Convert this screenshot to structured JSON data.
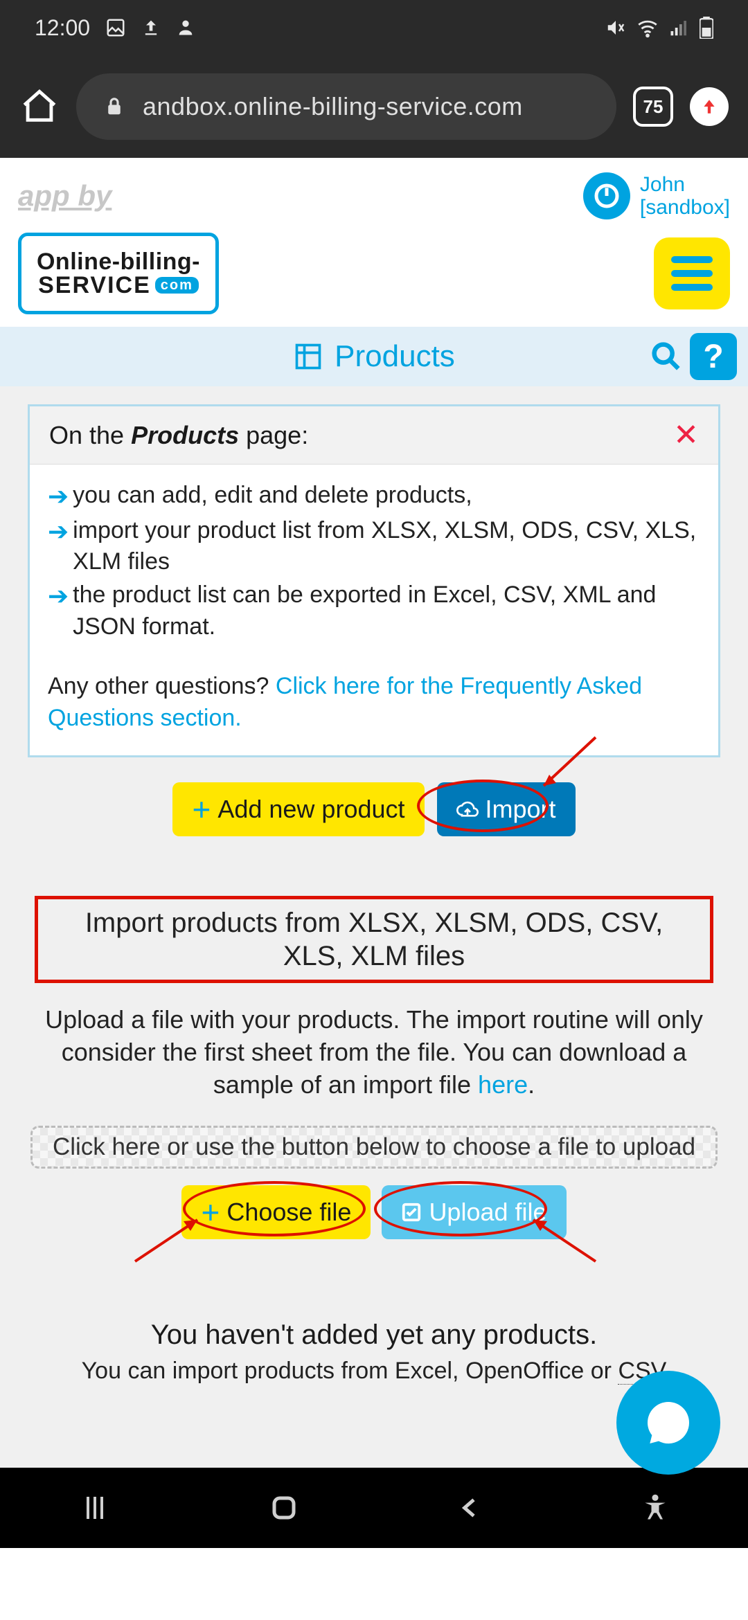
{
  "status": {
    "time": "12:00",
    "tab_count": "75"
  },
  "browser": {
    "url": "andbox.online-billing-service.com"
  },
  "header": {
    "app_by": "app by",
    "logo_l1": "Online-billing-",
    "logo_l2": "SERVICE",
    "logo_com": "com",
    "user_name": "John",
    "user_env": "[sandbox]"
  },
  "page": {
    "title": "Products",
    "help": "?"
  },
  "info": {
    "title_pre": "On the ",
    "title_em": "Products",
    "title_post": " page:",
    "bullets": [
      "you can add, edit and delete products,",
      "import your product list from XLSX, XLSM, ODS, CSV, XLS, XLM files",
      "the product list can be exported in Excel, CSV, XML and JSON format."
    ],
    "faq_pre": "Any other questions? ",
    "faq_link": "Click here for the Frequently Asked Questions section."
  },
  "actions": {
    "add": "Add new product",
    "import": "Import"
  },
  "import_section": {
    "title": "Import products from XLSX, XLSM, ODS, CSV, XLS, XLM files",
    "desc_pre": "Upload a file with your products. The import routine will only consider the first sheet from the file. You can download a sample of an import file ",
    "desc_link": "here",
    "upload_zone": "Click here or use the button below to choose a file to upload",
    "choose": "Choose file",
    "upload": "Upload file"
  },
  "empty": {
    "title": "You haven't added yet any products.",
    "sub_pre": "You can import products from Excel, OpenOffice or ",
    "sub_csv": "CSV"
  }
}
